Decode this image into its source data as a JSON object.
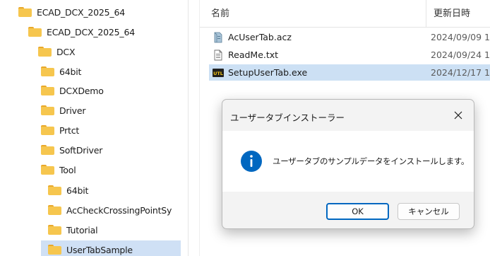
{
  "tree": {
    "items": [
      {
        "label": "ECAD_DCX_2025_64"
      },
      {
        "label": "ECAD_DCX_2025_64"
      },
      {
        "label": "DCX"
      },
      {
        "label": "64bit"
      },
      {
        "label": "DCXDemo"
      },
      {
        "label": "Driver"
      },
      {
        "label": "Prtct"
      },
      {
        "label": "SoftDriver"
      },
      {
        "label": "Tool"
      },
      {
        "label": "64bit"
      },
      {
        "label": "AcCheckCrossingPointSy"
      },
      {
        "label": "Tutorial"
      },
      {
        "label": "UserTabSample"
      }
    ]
  },
  "file_list": {
    "columns": {
      "name": "名前",
      "date": "更新日時"
    },
    "rows": [
      {
        "name": "AcUserTab.acz",
        "date": "2024/09/09 1",
        "icon": "archive-file-icon"
      },
      {
        "name": "ReadMe.txt",
        "date": "2024/09/24 1",
        "icon": "text-file-icon"
      },
      {
        "name": "SetupUserTab.exe",
        "date": "2024/12/17 1",
        "icon": "utl-exe-icon"
      }
    ]
  },
  "dialog": {
    "title": "ユーザータブインストーラー",
    "message": "ユーザータブのサンプルデータをインストールします。",
    "ok_label": "OK",
    "cancel_label": "キャンセル",
    "icon": "info-icon",
    "exe_icon_text": "UTL"
  },
  "colors": {
    "accent": "#0067c0",
    "folder": "#f6c64e",
    "selection": "#cce0f4"
  }
}
